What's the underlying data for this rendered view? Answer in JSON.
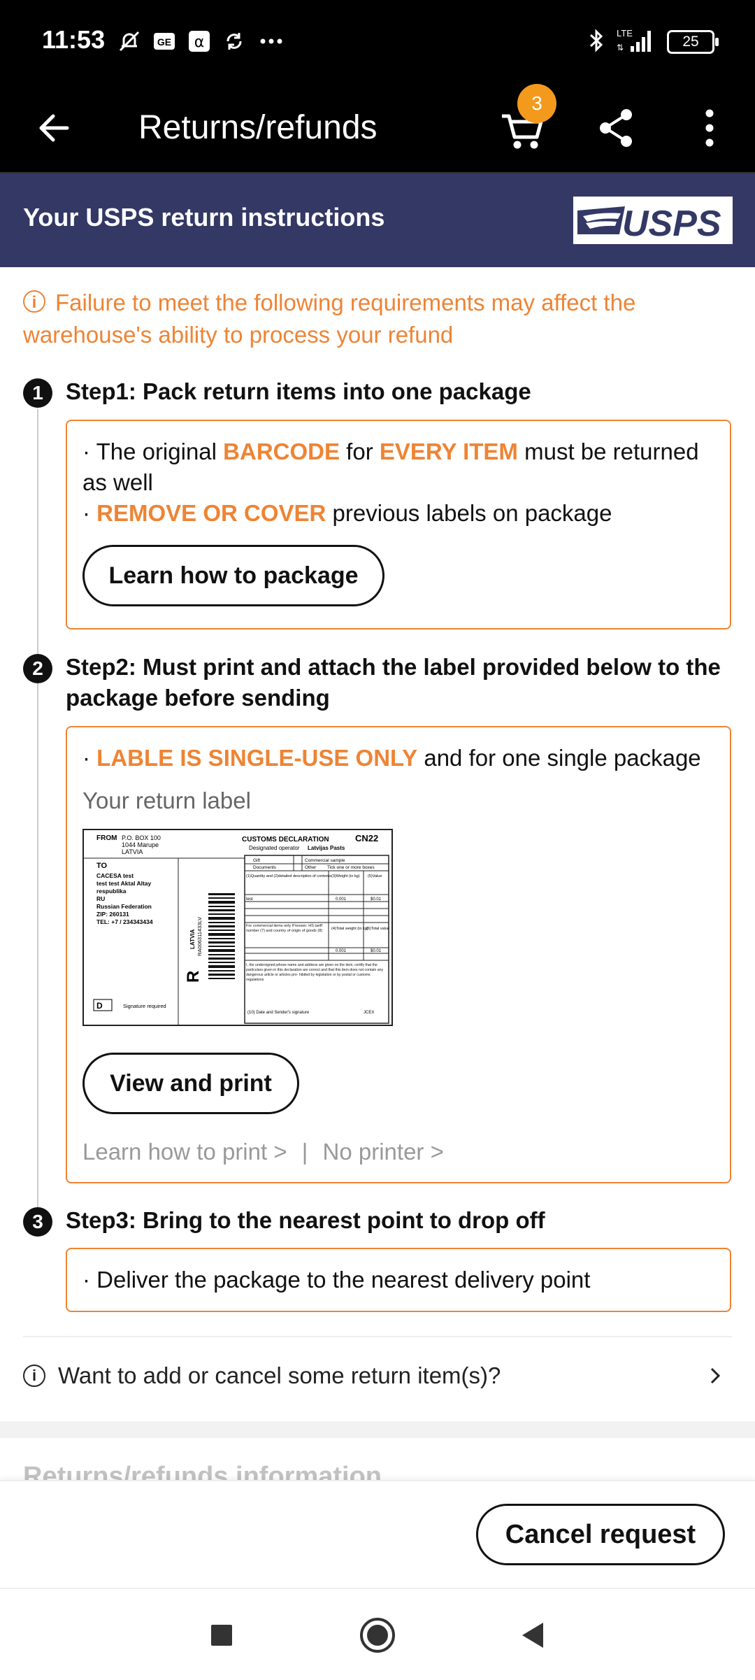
{
  "status_bar": {
    "time": "11:53",
    "network": "LTE",
    "battery": "25"
  },
  "app_bar": {
    "title": "Returns/refunds",
    "cart_count": "3"
  },
  "banner": {
    "title": "Your USPS return instructions",
    "logo_text": "USPS",
    "color": "#333865"
  },
  "warning": {
    "text": "Failure to meet the following requirements may affect the warehouse's ability to process your refund",
    "color": "#ee8434"
  },
  "steps": [
    {
      "number": "1",
      "title": "Step1: Pack return items into one package",
      "bullets": [
        {
          "pre": "The original ",
          "hl1": "BARCODE",
          "mid": " for ",
          "hl2": "EVERY ITEM",
          "post": " must be returned as well"
        },
        {
          "hl1": "REMOVE OR COVER",
          "post": " previous labels on package"
        }
      ],
      "button": "Learn how to package"
    },
    {
      "number": "2",
      "title": "Step2: Must print and attach the label provided below to the package before sending",
      "bullet": {
        "hl1": "LABLE IS SINGLE-USE ONLY",
        "post": " and for one single package"
      },
      "label_caption": "Your return label",
      "button": "View and print",
      "link_print": "Learn how to print >",
      "link_sep": "|",
      "link_noprinter": "No printer >"
    },
    {
      "number": "3",
      "title": "Step3: Bring to the nearest point to drop off",
      "bullet": "Deliver the package to the nearest delivery point"
    }
  ],
  "return_label": {
    "from_label": "FROM",
    "from_addr": [
      "P.O. BOX 100",
      "1044 Marupe",
      "LATVIA"
    ],
    "to_label": "TO",
    "to_addr": [
      "CACESA test",
      "test test Aktal Altay",
      "respublika",
      "RU",
      "Russian Federation",
      "ZIP:  260131",
      "TEL:  +7 / 234343434"
    ],
    "customs_title": "CUSTOMS  DECLARATION",
    "cn": "CN22",
    "operator_label": "Designated operator",
    "operator": "Latvijas Pasts",
    "gift": "Gift",
    "commercial": "Commercial sample",
    "documents": "Documents",
    "other": "Other",
    "tick": "Tick one or more boxes",
    "tracking": "RA006311433LV",
    "country": "LATVIA",
    "r_letter": "R",
    "d_mark": "D",
    "signature": "Signature required",
    "desc_hdr": "(1)Quantity and (2)detailed description of contents",
    "weight_hdr": "(3)Weight (in kg)",
    "value_hdr": "(5)Value",
    "item": "test",
    "weight": "0.001",
    "value": "$0.01",
    "commercial_note": "For commercial items only If known: HS tariff number (7) and country of origin of goods (8)",
    "total_weight_hdr": "(4)Total weight (in kg)",
    "total_value_hdr": "(6)Total value",
    "total_weight": "0.001",
    "total_value": "$0.01",
    "certify": "I, the undersigned,whose name and address are given on the item, certify that the particulars given in this declaration are correct and that this item does not contain any dangerous article or articles pro- hibited by legislation or by postal or customs regulations",
    "date_sig": "(10) Date and Sender's signature",
    "jcex": "JCEX"
  },
  "add_cancel": {
    "text": "Want to add or cancel some return item(s)?"
  },
  "section": {
    "title": "Returns/refunds information"
  },
  "bottom": {
    "cancel_button": "Cancel request"
  },
  "nav": {
    "icons": [
      "recents-square-icon",
      "home-circle-icon",
      "back-triangle-icon"
    ]
  }
}
